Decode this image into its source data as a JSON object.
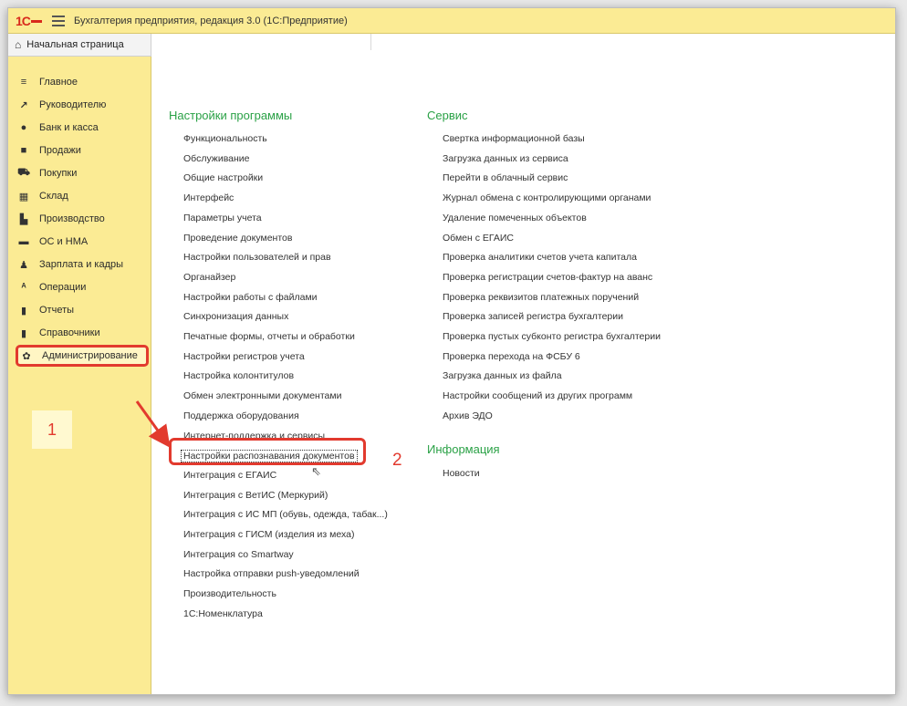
{
  "window": {
    "title": "Бухгалтерия предприятия, редакция 3.0  (1С:Предприятие)",
    "logo": "1С"
  },
  "home_tab": {
    "label": "Начальная страница"
  },
  "sidebar": {
    "items": [
      {
        "label": "Главное",
        "icon": "list-icon",
        "glyph": "≡"
      },
      {
        "label": "Руководителю",
        "icon": "trend-icon",
        "glyph": "↗"
      },
      {
        "label": "Банк и касса",
        "icon": "coin-icon",
        "glyph": "●"
      },
      {
        "label": "Продажи",
        "icon": "bag-icon",
        "glyph": "■"
      },
      {
        "label": "Покупки",
        "icon": "cart-icon",
        "glyph": "⛟"
      },
      {
        "label": "Склад",
        "icon": "warehouse-icon",
        "glyph": "▦"
      },
      {
        "label": "Производство",
        "icon": "factory-icon",
        "glyph": "▙"
      },
      {
        "label": "ОС и НМА",
        "icon": "truck-icon",
        "glyph": "▬"
      },
      {
        "label": "Зарплата и кадры",
        "icon": "person-icon",
        "glyph": "♟"
      },
      {
        "label": "Операции",
        "icon": "operations-icon",
        "glyph": "ᴬ"
      },
      {
        "label": "Отчеты",
        "icon": "bar-chart-icon",
        "glyph": "▮"
      },
      {
        "label": "Справочники",
        "icon": "book-icon",
        "glyph": "▮"
      },
      {
        "label": "Администрирование",
        "icon": "gear-icon",
        "glyph": "✿"
      }
    ]
  },
  "annotations": {
    "step1": "1",
    "step2": "2"
  },
  "settings": {
    "title": "Настройки программы",
    "items": [
      "Функциональность",
      "Обслуживание",
      "Общие настройки",
      "Интерфейс",
      "Параметры учета",
      "Проведение документов",
      "Настройки пользователей и прав",
      "Органайзер",
      "Настройки работы с файлами",
      "Синхронизация данных",
      "Печатные формы, отчеты и обработки",
      "Настройки регистров учета",
      "Настройка колонтитулов",
      "Обмен электронными документами",
      "Поддержка оборудования",
      "Интернет-поддержка и сервисы",
      "Настройки распознавания документов",
      "Интеграция с ЕГАИС",
      "Интеграция с ВетИС (Меркурий)",
      "Интеграция с ИС МП (обувь, одежда, табак...)",
      "Интеграция с ГИСМ (изделия из меха)",
      "Интеграция со Smartway",
      "Настройка отправки push-уведомлений",
      "Производительность",
      "1С:Номенклатура"
    ]
  },
  "service": {
    "title": "Сервис",
    "items": [
      "Свертка информационной базы",
      "Загрузка данных из сервиса",
      "Перейти в облачный сервис",
      "Журнал обмена с контролирующими органами",
      "Удаление помеченных объектов",
      "Обмен с ЕГАИС",
      "Проверка аналитики счетов учета капитала",
      "Проверка регистрации счетов-фактур на аванс",
      "Проверка реквизитов платежных поручений",
      "Проверка записей регистра бухгалтерии",
      "Проверка пустых субконто регистра бухгалтерии",
      "Проверка перехода на ФСБУ 6",
      "Загрузка данных из файла",
      "Настройки сообщений из других программ",
      "Архив ЭДО"
    ]
  },
  "info": {
    "title": "Информация",
    "items": [
      "Новости"
    ]
  },
  "colors": {
    "sidebar_bg": "#fbeb94",
    "section_title": "#2aa146",
    "highlight": "#e23a2e"
  }
}
